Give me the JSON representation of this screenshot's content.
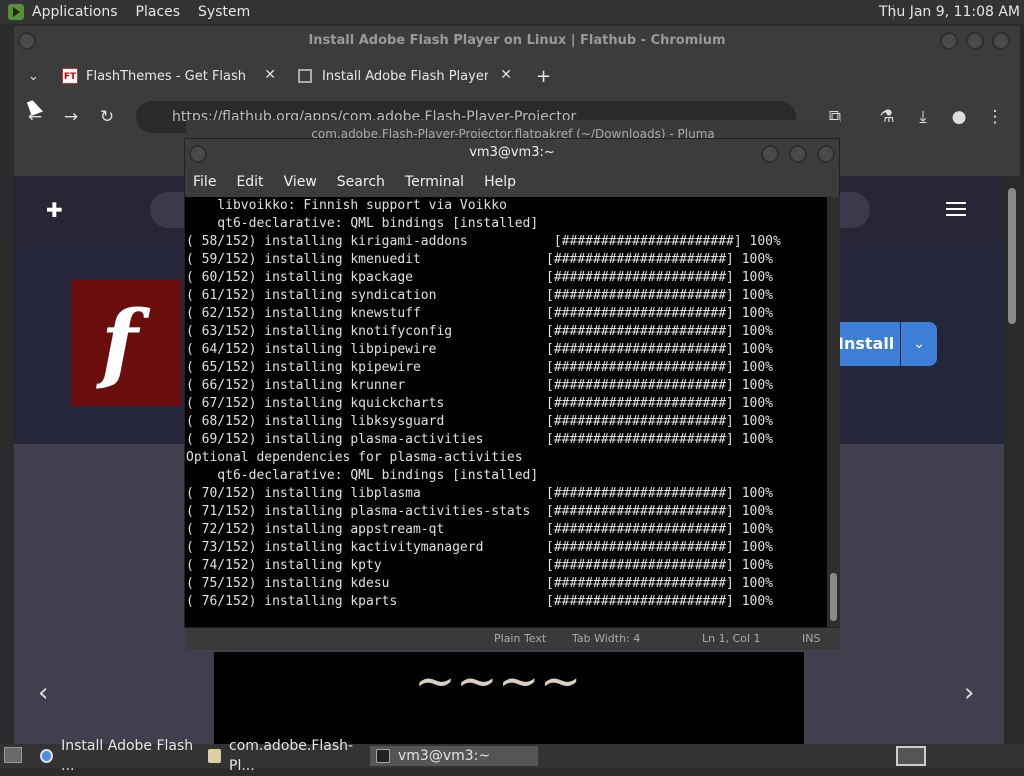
{
  "top_panel": {
    "menus": [
      "Applications",
      "Places",
      "System"
    ],
    "clock": "Thu Jan  9, 11:08 AM"
  },
  "chrome": {
    "window_title": "Install Adobe Flash Player on Linux | Flathub - Chromium",
    "tabs": [
      {
        "label": "FlashThemes - Get Flash",
        "favicon": "FT"
      },
      {
        "label": "Install Adobe Flash Player on"
      }
    ],
    "url": "https://flathub.org/apps/com.adobe.Flash-Player-Projector",
    "page": {
      "install_label": "Install"
    }
  },
  "pluma": {
    "window_title": "com.adobe.Flash-Player-Projector.flatpakref (~/Downloads) - Pluma",
    "status": {
      "syntax": "Plain Text",
      "tab_width": "Tab Width:  4",
      "position": "Ln 1, Col 1",
      "mode": "INS"
    }
  },
  "terminal": {
    "window_title": "vm3@vm3:~",
    "menu": [
      "File",
      "Edit",
      "View",
      "Search",
      "Terminal",
      "Help"
    ],
    "lines": [
      "    libvoikko: Finnish support via Voikko",
      "    qt6-declarative: QML bindings [installed]",
      "( 58/152) installing kirigami-addons           [######################] 100%",
      "( 59/152) installing kmenuedit                [######################] 100%",
      "( 60/152) installing kpackage                 [######################] 100%",
      "( 61/152) installing syndication              [######################] 100%",
      "( 62/152) installing knewstuff                [######################] 100%",
      "( 63/152) installing knotifyconfig            [######################] 100%",
      "( 64/152) installing libpipewire              [######################] 100%",
      "( 65/152) installing kpipewire                [######################] 100%",
      "( 66/152) installing krunner                  [######################] 100%",
      "( 67/152) installing kquickcharts             [######################] 100%",
      "( 68/152) installing libksysguard             [######################] 100%",
      "( 69/152) installing plasma-activities        [######################] 100%",
      "Optional dependencies for plasma-activities",
      "    qt6-declarative: QML bindings [installed]",
      "( 70/152) installing libplasma                [######################] 100%",
      "( 71/152) installing plasma-activities-stats  [######################] 100%",
      "( 72/152) installing appstream-qt             [######################] 100%",
      "( 73/152) installing kactivitymanagerd        [######################] 100%",
      "( 74/152) installing kpty                     [######################] 100%",
      "( 75/152) installing kdesu                    [######################] 100%",
      "( 76/152) installing kparts                   [######################] 100%"
    ]
  },
  "taskbar": {
    "items": [
      {
        "label": "Install Adobe Flash ..."
      },
      {
        "label": "com.adobe.Flash-Pl..."
      },
      {
        "label": "vm3@vm3:~"
      }
    ]
  }
}
